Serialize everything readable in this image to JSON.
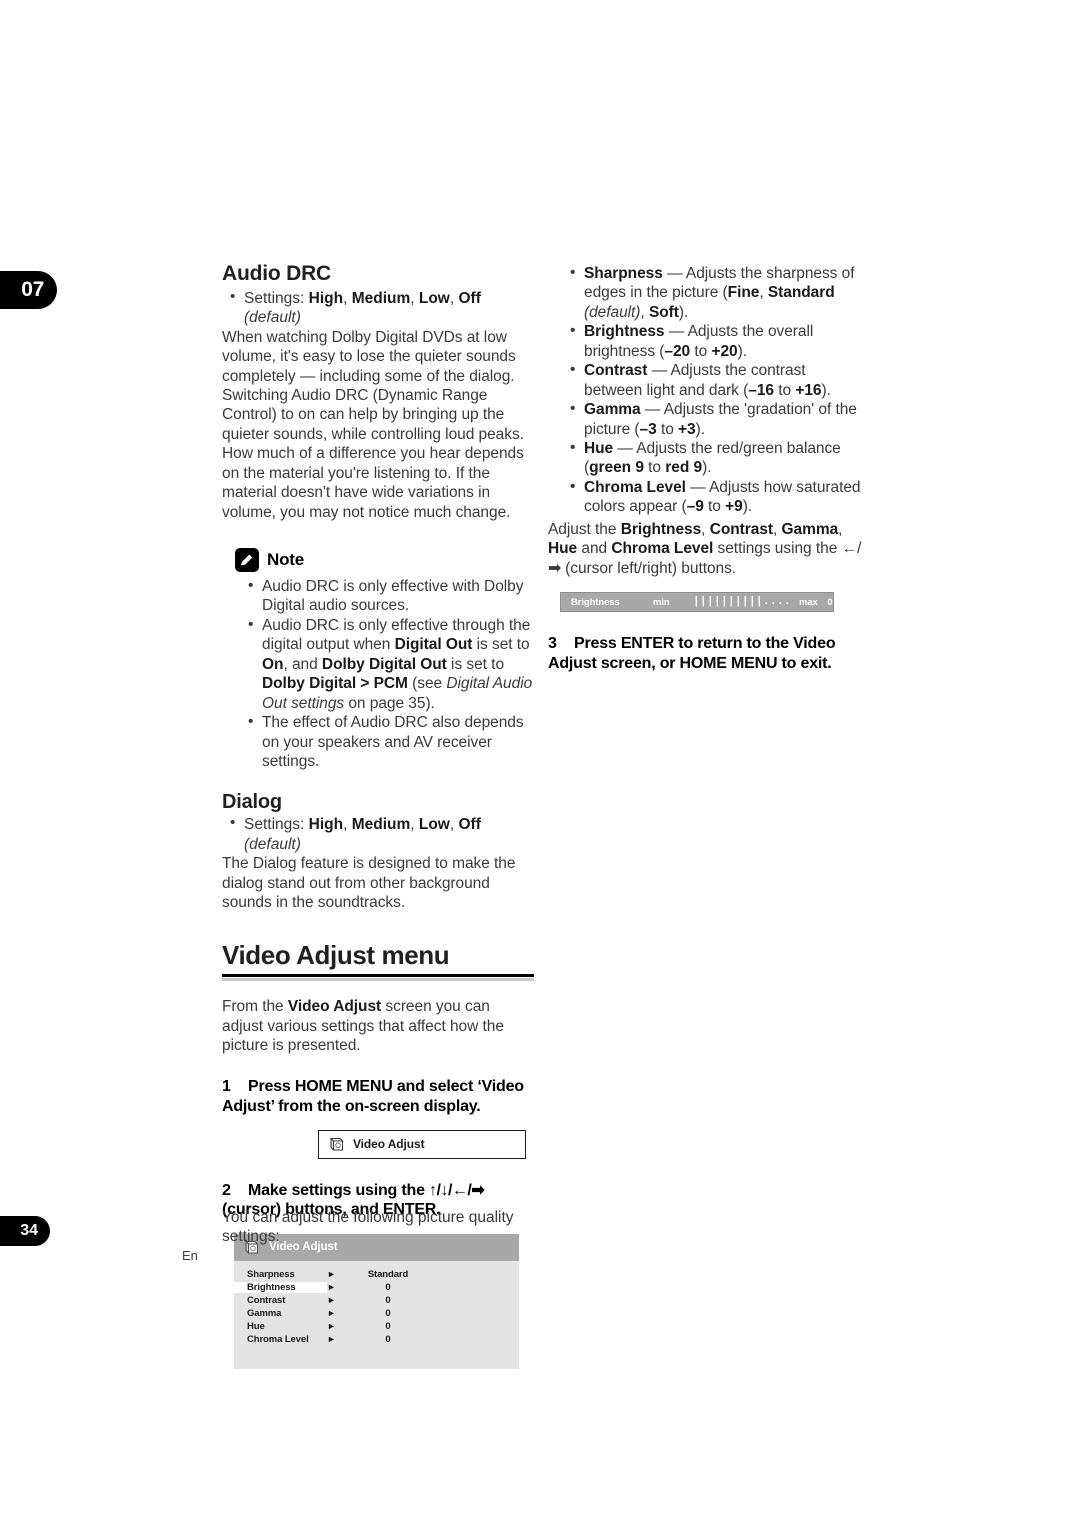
{
  "page": {
    "chapter_number": "07",
    "page_number": "34",
    "language_code": "En"
  },
  "left_column": {
    "section_title": "Audio DRC",
    "settings_line": {
      "prefix": "Settings: ",
      "options": [
        "High",
        "Medium",
        "Low",
        "Off"
      ],
      "default_note": "(default)"
    },
    "body_paragraph": "When watching Dolby Digital DVDs at low volume, it's easy to lose the quieter sounds completely — including some of the dialog. Switching Audio DRC (Dynamic Range Control) to on can help by bringing up the quieter sounds, while controlling loud peaks. How much of a difference you hear depends on the material you're listening to. If the material doesn't have wide variations in volume, you may not notice much change.",
    "note": {
      "label": "Note",
      "icon": "pencil-icon",
      "bullets": [
        "Audio DRC is only effective with Dolby Digital audio sources.",
        "Audio DRC is only effective through the digital output when Digital Out is set to On, and Dolby Digital Out is set to Dolby Digital > PCM (see Digital Audio Out settings on page 35).",
        "The effect of Audio DRC also depends on your speakers and AV receiver settings."
      ]
    },
    "dialog": {
      "title": "Dialog",
      "settings_prefix": "Settings: ",
      "options": [
        "High",
        "Medium",
        "Low",
        "Off"
      ],
      "default_note": "(default)",
      "body": "The Dialog feature is designed to make the dialog stand out from other background sounds in the soundtracks."
    },
    "video_adjust": {
      "major_title": "Video Adjust menu",
      "intro": "From the Video Adjust screen you can adjust various settings that affect how the picture is presented.",
      "step1": {
        "number": "1",
        "text": "Press HOME MENU and select ‘Video Adjust’ from the on-screen display."
      },
      "osd_button_label": "Video Adjust",
      "step2": {
        "number": "2",
        "text_before": "Make settings using the ",
        "arrows": "↑/↓/←/➡",
        "text_after": "(cursor) buttons, and ENTER."
      },
      "osd_panel": {
        "header": "Video Adjust",
        "rows": [
          {
            "name": "Sharpness",
            "arrow": "►",
            "value": "Standard",
            "selected": false
          },
          {
            "name": "Brightness",
            "arrow": "►",
            "value": "0",
            "selected": true
          },
          {
            "name": "Contrast",
            "arrow": "►",
            "value": "0",
            "selected": false
          },
          {
            "name": "Gamma",
            "arrow": "►",
            "value": "0",
            "selected": false
          },
          {
            "name": "Hue",
            "arrow": "►",
            "value": "0",
            "selected": false
          },
          {
            "name": "Chroma Level",
            "arrow": "►",
            "value": "0",
            "selected": false
          }
        ]
      }
    },
    "footer_text": "You can adjust the following picture quality settings:"
  },
  "right_column": {
    "bullets": [
      {
        "term": "Sharpness",
        "dash": " — ",
        "description": "Adjusts the sharpness of edges in the picture (",
        "values": "Fine, Standard (default), Soft",
        "tail": ")."
      },
      {
        "term": "Brightness",
        "dash": " — ",
        "description": "Adjusts the overall brightness (",
        "values": "–20 to +20",
        "tail": ")."
      },
      {
        "term": "Contrast",
        "dash": " — ",
        "description": "Adjusts the contrast between light and dark (",
        "values": "–16 to +16",
        "tail": ")."
      },
      {
        "term": "Gamma",
        "dash": " — ",
        "description": "Adjusts the 'gradation' of the picture (",
        "values": "–3 to +3",
        "tail": ")."
      },
      {
        "term": "Hue",
        "dash": " — ",
        "description": "Adjusts the red/green balance (",
        "values": "green 9 to red 9",
        "tail": ")."
      },
      {
        "term": "Chroma Level",
        "dash": " — ",
        "description": "Adjusts how saturated colors appear (",
        "values": "–9 to +9",
        "tail": ")."
      }
    ],
    "adjust_paragraph": {
      "lead": "Adjust the ",
      "terms": "Brightness, Contrast, Gamma, Hue and Chroma Level",
      "mid": " settings using the ",
      "arrows": "←/ ➡",
      "tail": " (cursor left/right) buttons."
    },
    "slider": {
      "name": "Brightness",
      "min_label": "min",
      "max_label": "max",
      "value": "0",
      "filled_ticks": "||||||||||",
      "empty_ticks": ".........."
    },
    "step3": {
      "number": "3",
      "text": "Press ENTER to return to the Video Adjust screen, or HOME MENU to exit."
    }
  },
  "colors": {
    "osd_header": "#a8a8a8",
    "osd_body": "#e4e4e4",
    "tab_black": "#000000",
    "body_text": "#3a3a3a"
  }
}
